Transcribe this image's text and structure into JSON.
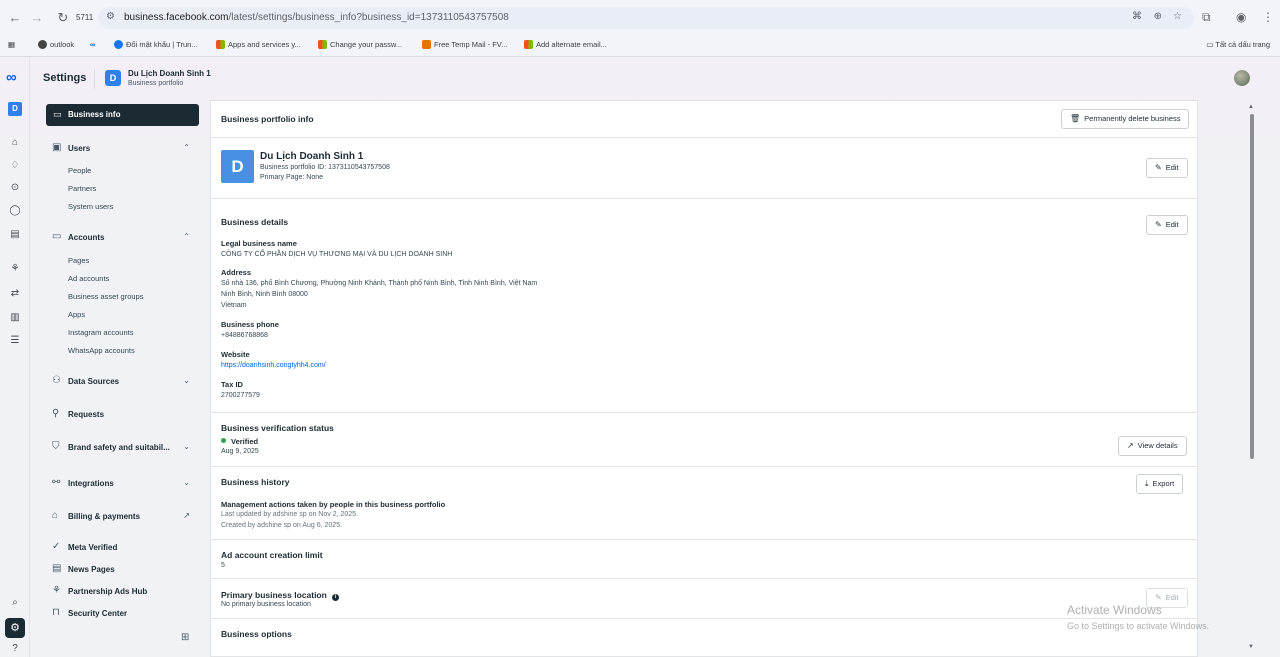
{
  "browser": {
    "tab_count": "5711",
    "url_host": "business.facebook.com",
    "url_path": "/latest/settings/business_info?business_id=1373110543757508",
    "bookmarks": [
      "outlook",
      "Đổi mật khẩu | Trun...",
      "Apps and services y...",
      "Change your passw...",
      "Free Temp Mail - FV...",
      "Add alternate email..."
    ],
    "all_bookmarks": "Tất cả dấu trang"
  },
  "header": {
    "title": "Settings",
    "avatar_letter": "D",
    "portfolio_name": "Du Lịch Doanh Sinh 1",
    "portfolio_type": "Business portfolio"
  },
  "sidebar": {
    "active_label": "Business info",
    "users": {
      "label": "Users",
      "items": [
        "People",
        "Partners",
        "System users"
      ]
    },
    "accounts": {
      "label": "Accounts",
      "items": [
        "Pages",
        "Ad accounts",
        "Business asset groups",
        "Apps",
        "Instagram accounts",
        "WhatsApp accounts"
      ]
    },
    "data_sources": "Data Sources",
    "requests": "Requests",
    "brand_safety": "Brand safety and suitabil...",
    "integrations": "Integrations",
    "billing": "Billing & payments",
    "meta_verified": "Meta Verified",
    "news_pages": "News Pages",
    "partnership_ads": "Partnership Ads Hub",
    "security_center": "Security Center"
  },
  "main": {
    "portfolio_info_title": "Business portfolio info",
    "delete_button": "Permanently delete business",
    "profile": {
      "avatar_letter": "D",
      "name": "Du Lịch Doanh Sinh 1",
      "id_line": "Business portfolio ID: 1373110543757508",
      "primary_page": "Primary Page: None",
      "edit": "Edit"
    },
    "details": {
      "title": "Business details",
      "edit": "Edit",
      "legal_name_label": "Legal business name",
      "legal_name": "CÔNG TY CỔ PHẦN DỊCH VỤ THƯƠNG MẠI VÀ DU LỊCH DOANH SINH",
      "address_label": "Address",
      "address_line1": "Số nhà 136, phố Bình Chương, Phường Ninh Khánh, Thành phố Ninh Bình, Tỉnh Ninh Bình, Việt Nam",
      "address_line2": "Ninh Bình, Ninh Bình 08000",
      "address_line3": "Vietnam",
      "phone_label": "Business phone",
      "phone": "+84886768868",
      "website_label": "Website",
      "website": "https://doanhsinh.congtyhh4.com/",
      "tax_label": "Tax ID",
      "tax": "2700277579"
    },
    "verification": {
      "title": "Business verification status",
      "status": "Verified",
      "date": "Aug 9, 2025",
      "button": "View details"
    },
    "history": {
      "title": "Business history",
      "subtitle": "Management actions taken by people in this business portfolio",
      "updated": "Last updated by adshine sp on Nov 2, 2025.",
      "created": "Created by adshine sp on Aug 6, 2025.",
      "button": "Export"
    },
    "ad_limit": {
      "title": "Ad account creation limit",
      "value": "5"
    },
    "location": {
      "title": "Primary business location",
      "value": "No primary business location",
      "edit": "Edit"
    },
    "options": {
      "title": "Business options"
    }
  },
  "watermark": {
    "line1": "Activate Windows",
    "line2": "Go to Settings to activate Windows."
  }
}
